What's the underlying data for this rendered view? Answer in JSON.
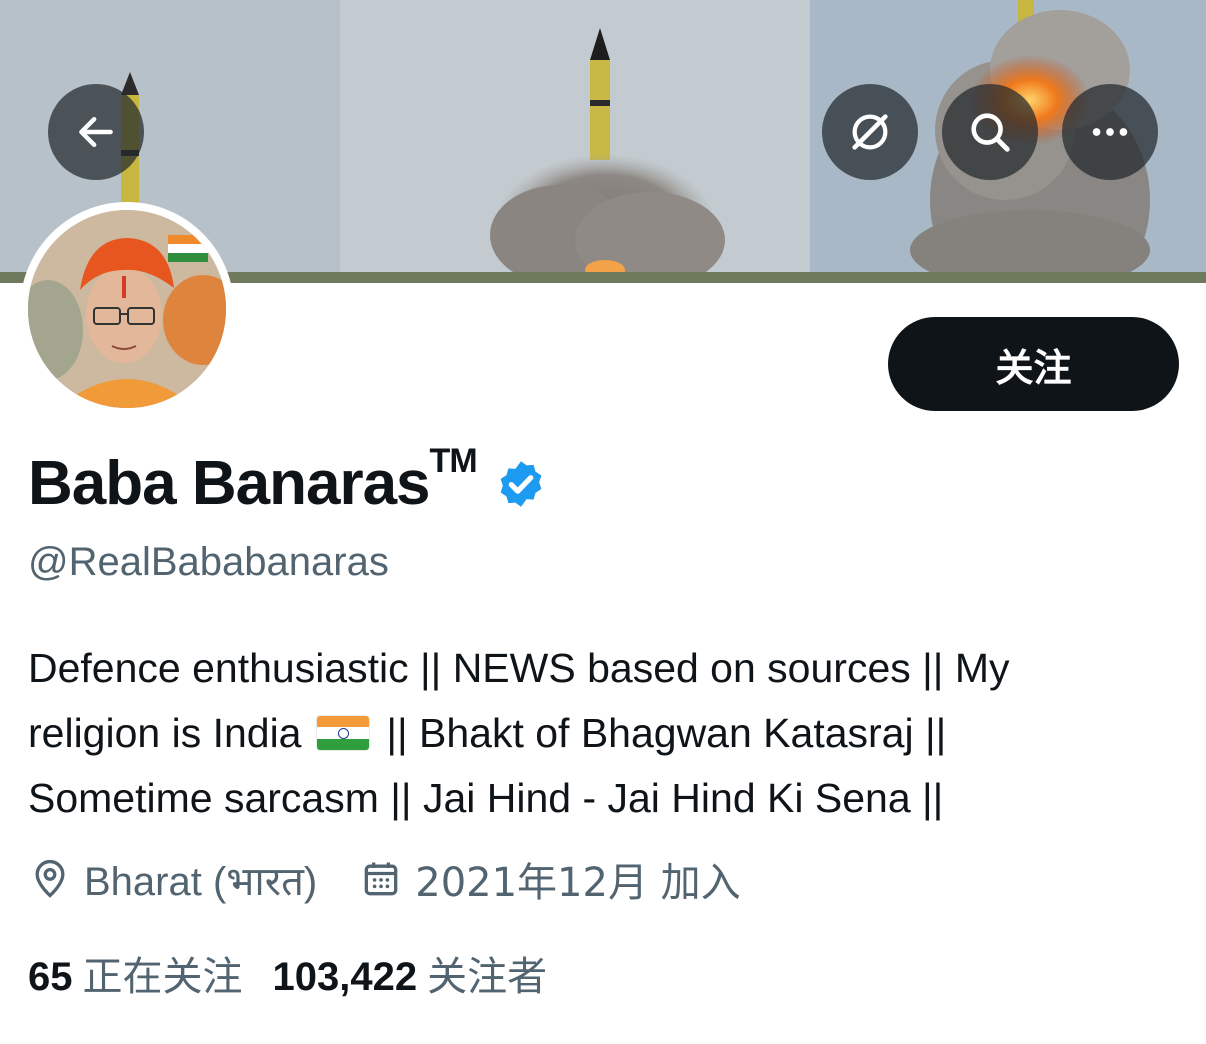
{
  "header": {
    "back_icon": "arrow-left-icon",
    "grok_icon": "grok-icon",
    "search_icon": "search-icon",
    "more_icon": "more-horizontal-icon"
  },
  "profile": {
    "display_name": "Baba Banaras",
    "trademark": "TM",
    "verified_icon": "verified-badge-icon",
    "verified_color": "#1d9bf0",
    "handle": "@RealBababanaras",
    "follow_label": "关注",
    "bio": {
      "line1": "Defence enthusiastic || NEWS based on sources || My",
      "line2_a": "religion is India",
      "line2_b": "|| Bhakt of Bhagwan Katasraj ||",
      "line3": "Sometime sarcasm || Jai Hind - Jai Hind Ki Sena ||"
    },
    "location": "Bharat (भारत)",
    "joined": "2021年12月 加入",
    "following_count": "65",
    "following_label": "正在关注",
    "followers_count": "103,422",
    "followers_label": "关注者"
  },
  "colors": {
    "text_primary": "#0f1419",
    "text_secondary": "#536471",
    "follow_button_bg": "#0f1419"
  }
}
